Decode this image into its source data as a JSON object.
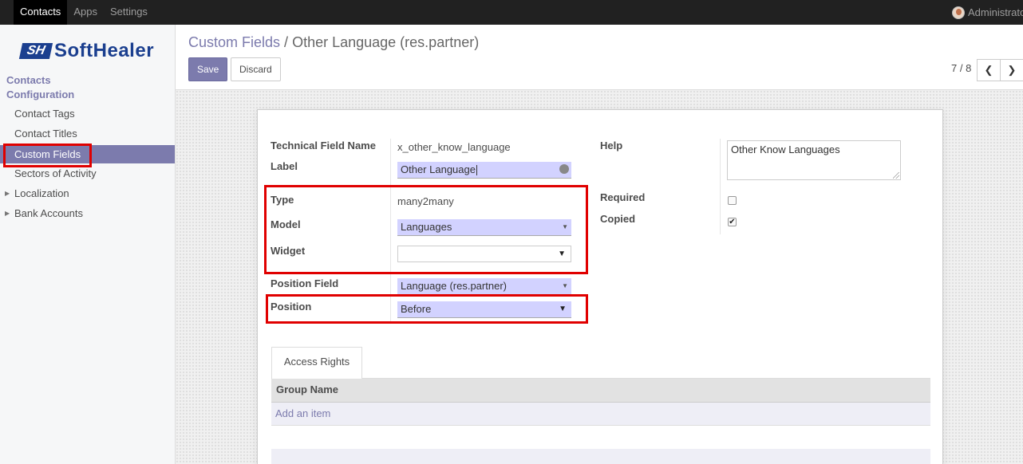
{
  "topbar": {
    "menu": [
      "Contacts",
      "Apps",
      "Settings"
    ],
    "user_name": "Administrator"
  },
  "sidebar": {
    "logo_mark": "SH",
    "logo_text": "SoftHealer",
    "section_contacts": "Contacts",
    "section_configuration": "Configuration",
    "items": [
      {
        "label": "Contact Tags"
      },
      {
        "label": "Contact Titles"
      },
      {
        "label": "Custom Fields"
      },
      {
        "label": "Sectors of Activity"
      },
      {
        "label": "Localization"
      },
      {
        "label": "Bank Accounts"
      }
    ]
  },
  "control": {
    "breadcrumb_parent": "Custom Fields",
    "breadcrumb_sep": "/",
    "breadcrumb_current": "Other Language (res.partner)",
    "save_label": "Save",
    "discard_label": "Discard",
    "pager": "7 / 8"
  },
  "form": {
    "technical_name_label": "Technical Field Name",
    "technical_name_value": "x_other_know_language",
    "label_label": "Label",
    "label_value": "Other Language",
    "type_label": "Type",
    "type_value": "many2many",
    "model_label": "Model",
    "model_value": "Languages",
    "widget_label": "Widget",
    "widget_value": "",
    "position_field_label": "Position Field",
    "position_field_value": "Language (res.partner)",
    "position_label": "Position",
    "position_value": "Before",
    "help_label": "Help",
    "help_value": "Other Know Languages",
    "required_label": "Required",
    "required_checked": false,
    "copied_label": "Copied",
    "copied_checked": true
  },
  "tabs": {
    "access_rights": "Access Rights"
  },
  "grid": {
    "column_group_name": "Group Name",
    "add_item": "Add an item"
  },
  "colors": {
    "brand": "#7c7bad",
    "highlight": "#e00000",
    "required_input": "#d2d2ff"
  },
  "icons": {
    "prev": "chevron-left-icon",
    "next": "chevron-right-icon",
    "translate": "globe-icon",
    "dropdown": "caret-down-icon",
    "checkmark": "check-icon"
  }
}
